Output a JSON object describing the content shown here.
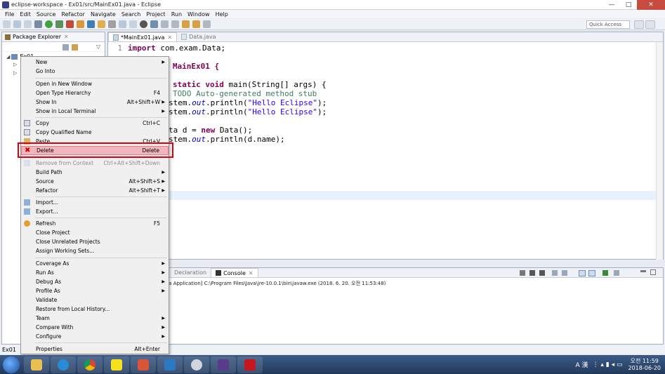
{
  "window": {
    "title": "eclipse-workspace - Ex01/src/MainEx01.java - Eclipse",
    "min": "—",
    "max": "□",
    "close": "✕"
  },
  "menu": [
    "File",
    "Edit",
    "Source",
    "Refactor",
    "Navigate",
    "Search",
    "Project",
    "Run",
    "Window",
    "Help"
  ],
  "toolbar": {
    "quick_access": "Quick Access"
  },
  "package_explorer": {
    "tab_label": "Package Explorer",
    "project": "Ex01"
  },
  "editor": {
    "tabs": [
      {
        "label": "*MainEx01.java",
        "active": true
      },
      {
        "label": "Data.java",
        "active": false
      }
    ],
    "lines": {
      "l1_num": "1",
      "l1_kw": "import",
      "l1_rest": " com.exam.Data;",
      "l3": "ss MainEx01 {",
      "l5_kw1": "static",
      "l5_kw2": "void",
      "l5_rest": " main(String[] args) {",
      "l6": "TODO Auto-generated method stub",
      "l7_pre": "stem.",
      "l7_fld": "out",
      "l7_mid": ".println(",
      "l7_str": "\"Hello Eclipse\"",
      "l7_end": ");",
      "l8_str": "\"Hello Eclipse\"",
      "l10_pre": "ta d = ",
      "l10_kw": "new",
      "l10_rest": " Data();",
      "l11_rest": ".println(d.name);"
    }
  },
  "console": {
    "tabs": [
      {
        "label": "Declaration",
        "active": false
      },
      {
        "label": "Console",
        "active": true
      }
    ],
    "info": "va Application] C:\\Program Files\\Java\\jre-10.0.1\\bin\\javaw.exe (2018. 6. 20. 오전 11:53:48)"
  },
  "statusbar": {
    "text": "Ex01"
  },
  "context_menu": {
    "items": [
      {
        "label": "New",
        "shortcut": "",
        "submenu": true
      },
      {
        "label": "Go Into",
        "shortcut": "",
        "submenu": false
      },
      {
        "label": "Open in New Window",
        "shortcut": "",
        "submenu": false
      },
      {
        "label": "Open Type Hierarchy",
        "shortcut": "F4",
        "submenu": false
      },
      {
        "label": "Show In",
        "shortcut": "Alt+Shift+W",
        "submenu": true
      },
      {
        "label": "Show in Local Terminal",
        "shortcut": "",
        "submenu": true
      },
      {
        "label": "Copy",
        "shortcut": "Ctrl+C",
        "submenu": false
      },
      {
        "label": "Copy Qualified Name",
        "shortcut": "",
        "submenu": false
      },
      {
        "label": "Paste",
        "shortcut": "Ctrl+V",
        "submenu": false
      },
      {
        "label": "Delete",
        "shortcut": "Delete",
        "submenu": false
      },
      {
        "label": "Remove from Context",
        "shortcut": "Ctrl+Alt+Shift+Down",
        "submenu": false
      },
      {
        "label": "Build Path",
        "shortcut": "",
        "submenu": true
      },
      {
        "label": "Source",
        "shortcut": "Alt+Shift+S",
        "submenu": true
      },
      {
        "label": "Refactor",
        "shortcut": "Alt+Shift+T",
        "submenu": true
      },
      {
        "label": "Import...",
        "shortcut": "",
        "submenu": false
      },
      {
        "label": "Export...",
        "shortcut": "",
        "submenu": false
      },
      {
        "label": "Refresh",
        "shortcut": "F5",
        "submenu": false
      },
      {
        "label": "Close Project",
        "shortcut": "",
        "submenu": false
      },
      {
        "label": "Close Unrelated Projects",
        "shortcut": "",
        "submenu": false
      },
      {
        "label": "Assign Working Sets...",
        "shortcut": "",
        "submenu": false
      },
      {
        "label": "Coverage As",
        "shortcut": "",
        "submenu": true
      },
      {
        "label": "Run As",
        "shortcut": "",
        "submenu": true
      },
      {
        "label": "Debug As",
        "shortcut": "",
        "submenu": true
      },
      {
        "label": "Profile As",
        "shortcut": "",
        "submenu": true
      },
      {
        "label": "Validate",
        "shortcut": "",
        "submenu": false
      },
      {
        "label": "Restore from Local History...",
        "shortcut": "",
        "submenu": false
      },
      {
        "label": "Team",
        "shortcut": "",
        "submenu": true
      },
      {
        "label": "Compare With",
        "shortcut": "",
        "submenu": true
      },
      {
        "label": "Configure",
        "shortcut": "",
        "submenu": true
      },
      {
        "label": "Properties",
        "shortcut": "Alt+Enter",
        "submenu": false
      }
    ]
  },
  "taskbar": {
    "lang": "A 漢",
    "clock_time": "오전 11:59",
    "clock_date": "2018-06-20"
  }
}
